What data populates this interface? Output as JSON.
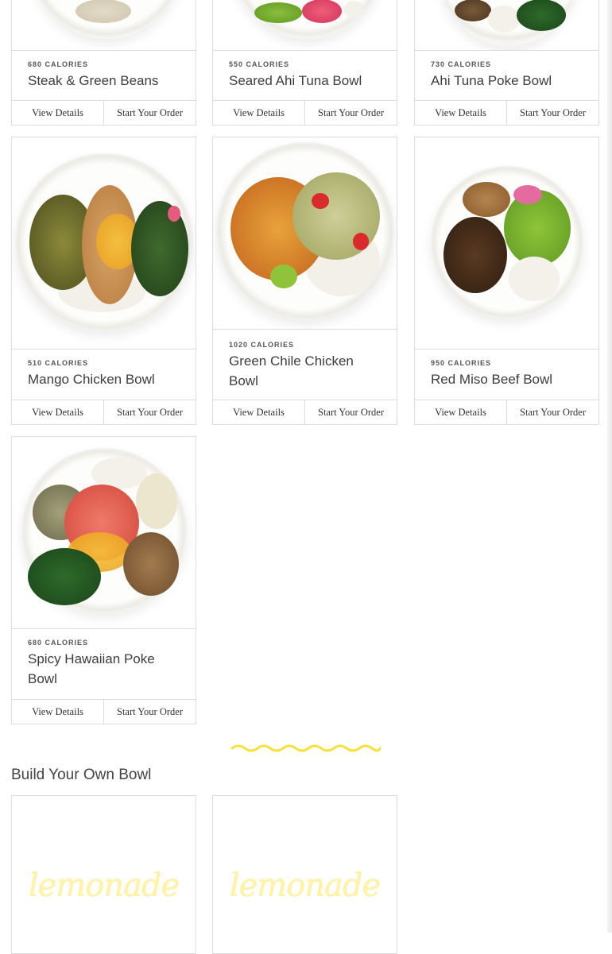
{
  "actions": {
    "view_details": "View Details",
    "start_order": "Start Your Order"
  },
  "bowls": [
    {
      "calories": "680 CALORIES",
      "name": "Steak & Green Beans"
    },
    {
      "calories": "550 CALORIES",
      "name": "Seared Ahi Tuna Bowl"
    },
    {
      "calories": "730 CALORIES",
      "name": "Ahi Tuna Poke Bowl"
    },
    {
      "calories": "510 CALORIES",
      "name": "Mango Chicken Bowl"
    },
    {
      "calories": "1020 CALORIES",
      "name": "Green Chile Chicken Bowl"
    },
    {
      "calories": "950 CALORIES",
      "name": "Red Miso Beef Bowl"
    },
    {
      "calories": "680 CALORIES",
      "name": "Spicy Hawaiian Poke Bowl"
    }
  ],
  "build_section": {
    "title": "Build Your Own Bowl",
    "placeholder_logo": "lemonade"
  },
  "colors": {
    "accent_yellow": "#f5e23a",
    "border": "#dcdcdc",
    "text": "#3d3d3d"
  }
}
